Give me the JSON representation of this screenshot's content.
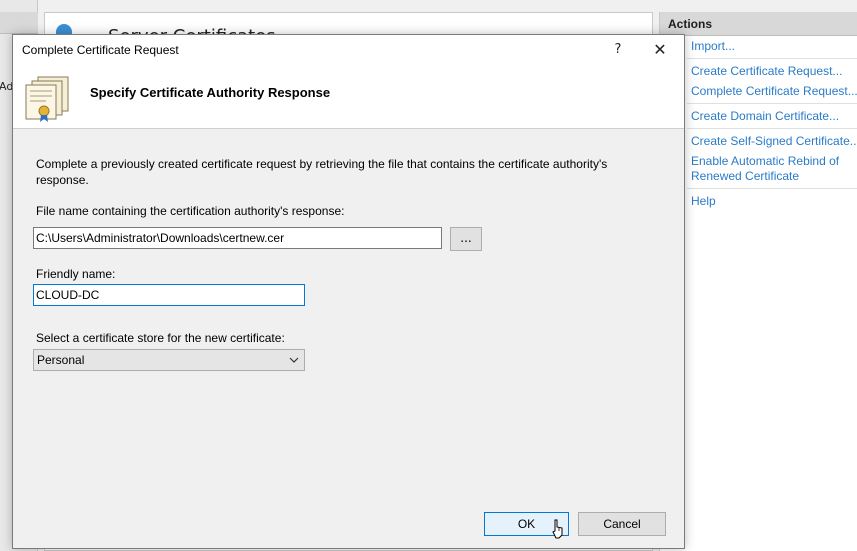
{
  "background": {
    "left_truncated_text": "Adm",
    "center_title": "Server Certificates",
    "actions": {
      "header": "Actions",
      "items": [
        {
          "label": "Import...",
          "group": 1
        },
        {
          "label": "Create Certificate Request...",
          "group": 2
        },
        {
          "label": "Complete Certificate Request...",
          "group": 2
        },
        {
          "label": "Create Domain Certificate...",
          "group": 3
        },
        {
          "label": "Create Self-Signed Certificate...",
          "group": 4
        },
        {
          "label": "Enable Automatic Rebind of Renewed Certificate",
          "group": 4
        },
        {
          "label": "Help",
          "group": 5
        }
      ]
    }
  },
  "dialog": {
    "title": "Complete Certificate Request",
    "help_glyph": "?",
    "close_glyph": "✕",
    "header_title": "Specify Certificate Authority Response",
    "description": "Complete a previously created certificate request by retrieving the file that contains the certificate authority's response.",
    "file_label": "File name containing the certification authority's response:",
    "file_value": "C:\\Users\\Administrator\\Downloads\\certnew.cer",
    "browse_label": "...",
    "friendly_label": "Friendly name:",
    "friendly_value": "CLOUD-DC",
    "store_label": "Select a certificate store for the new certificate:",
    "store_value": "Personal",
    "ok_label": "OK",
    "cancel_label": "Cancel"
  },
  "colors": {
    "link": "#2a7bc8",
    "focus": "#0078d7",
    "dialog_bg": "#f0f0f0"
  }
}
